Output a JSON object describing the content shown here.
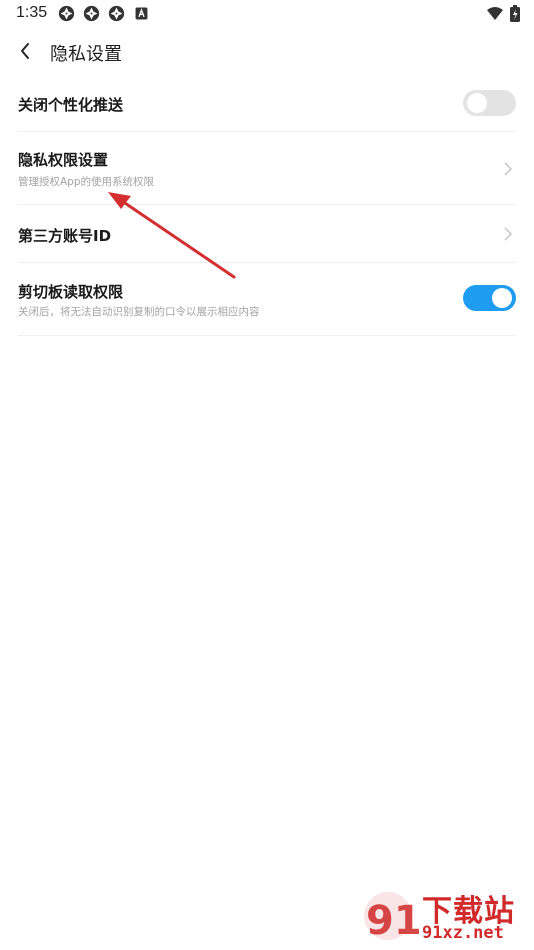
{
  "status_bar": {
    "time": "1:35",
    "left_icons": [
      "app-notification-icon",
      "app-notification-icon",
      "app-notification-icon",
      "a-badge-icon"
    ],
    "right_icons": [
      "wifi-icon",
      "battery-charging-icon"
    ]
  },
  "header": {
    "title": "隐私设置",
    "back_icon": "chevron-left-icon"
  },
  "settings": [
    {
      "title": "关闭个性化推送",
      "subtitle": "",
      "control": "toggle",
      "on": false
    },
    {
      "title": "隐私权限设置",
      "subtitle": "管理授权App的使用系统权限",
      "control": "chevron"
    },
    {
      "title": "第三方账号ID",
      "subtitle": "",
      "control": "chevron"
    },
    {
      "title": "剪切板读取权限",
      "subtitle": "关闭后，将无法自动识别复制的口令以展示相应内容",
      "control": "toggle",
      "on": true
    }
  ],
  "colors": {
    "toggle_on": "#1e9cf0",
    "toggle_off": "#e3e3e3",
    "annotation_arrow": "#d32f2f",
    "watermark": "#d02a2a"
  },
  "watermark": {
    "cn": "下载站",
    "en": "91xz.net",
    "logo": "91"
  }
}
